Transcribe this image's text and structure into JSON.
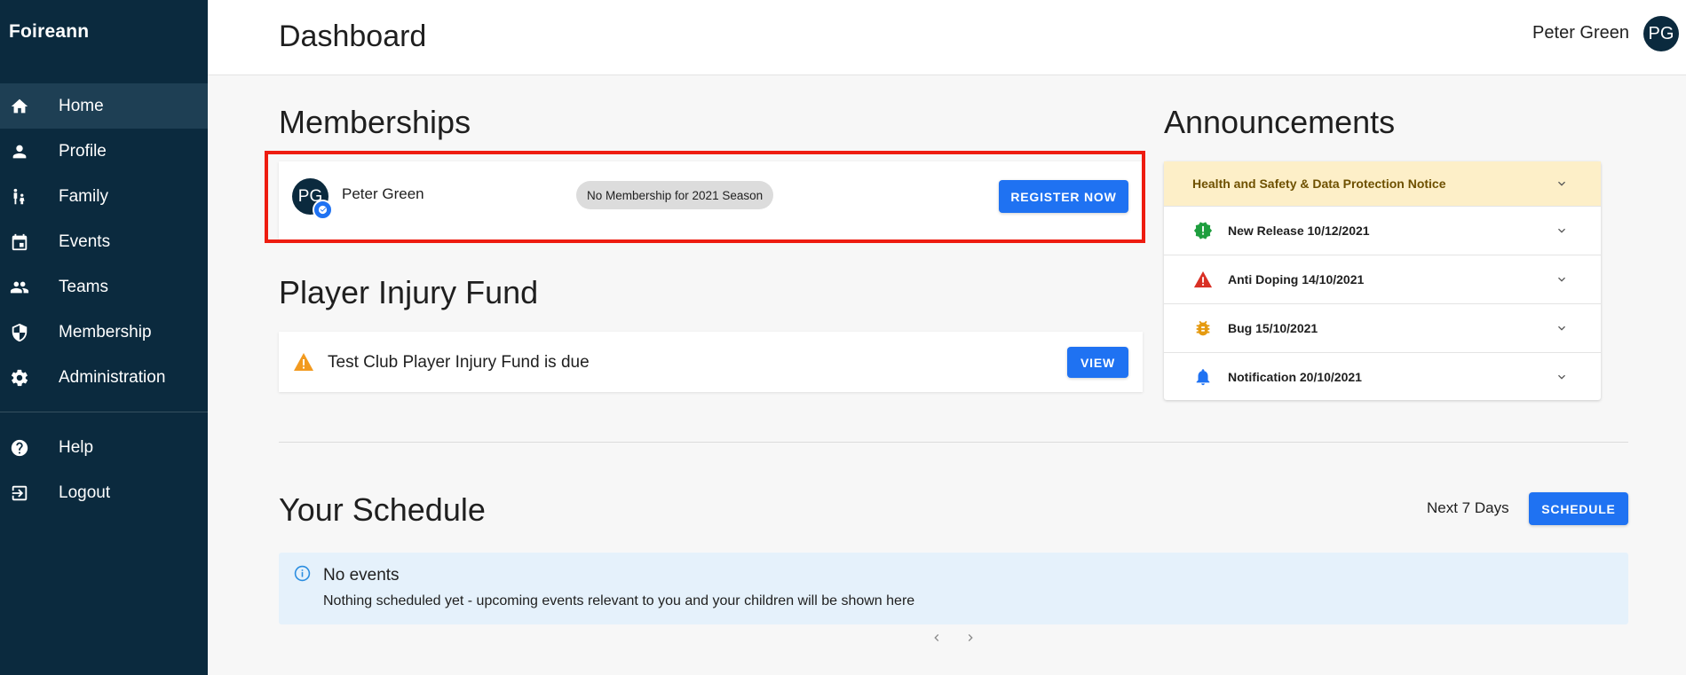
{
  "app": {
    "brand": "Foireann"
  },
  "sidebar": {
    "items": [
      {
        "label": "Home",
        "icon": "home-icon"
      },
      {
        "label": "Profile",
        "icon": "person-icon"
      },
      {
        "label": "Family",
        "icon": "family-icon"
      },
      {
        "label": "Events",
        "icon": "calendar-icon"
      },
      {
        "label": "Teams",
        "icon": "group-icon"
      },
      {
        "label": "Membership",
        "icon": "shield-icon"
      },
      {
        "label": "Administration",
        "icon": "gear-icon"
      }
    ],
    "bottom_items": [
      {
        "label": "Help",
        "icon": "help-icon"
      },
      {
        "label": "Logout",
        "icon": "logout-icon"
      }
    ],
    "active": "Home"
  },
  "header": {
    "title": "Dashboard",
    "user_name": "Peter Green",
    "avatar_initials": "PG"
  },
  "memberships": {
    "heading": "Memberships",
    "member": {
      "initials": "PG",
      "name": "Peter Green",
      "status": "No Membership for 2021 Season"
    },
    "register_label": "REGISTER NOW"
  },
  "injury_fund": {
    "heading": "Player Injury Fund",
    "message": "Test Club Player Injury Fund is due",
    "view_label": "VIEW"
  },
  "announcements": {
    "heading": "Announcements",
    "items": [
      {
        "label": "Health and Safety & Data Protection Notice",
        "icon": "none"
      },
      {
        "label": "New Release 10/12/2021",
        "icon": "new-release-icon"
      },
      {
        "label": "Anti Doping 14/10/2021",
        "icon": "warning-icon"
      },
      {
        "label": "Bug 15/10/2021",
        "icon": "bug-icon"
      },
      {
        "label": "Notification 20/10/2021",
        "icon": "bell-icon"
      }
    ]
  },
  "schedule": {
    "heading": "Your Schedule",
    "range_label": "Next 7 Days",
    "button_label": "SCHEDULE",
    "empty_title": "No events",
    "empty_message": "Nothing scheduled yet - upcoming events relevant to you and your children will be shown here"
  },
  "colors": {
    "sidebar_bg": "#0b2a3e",
    "accent": "#1f72f2",
    "highlight_border": "#ee1c10",
    "announcement_highlight": "#fdefc8"
  }
}
